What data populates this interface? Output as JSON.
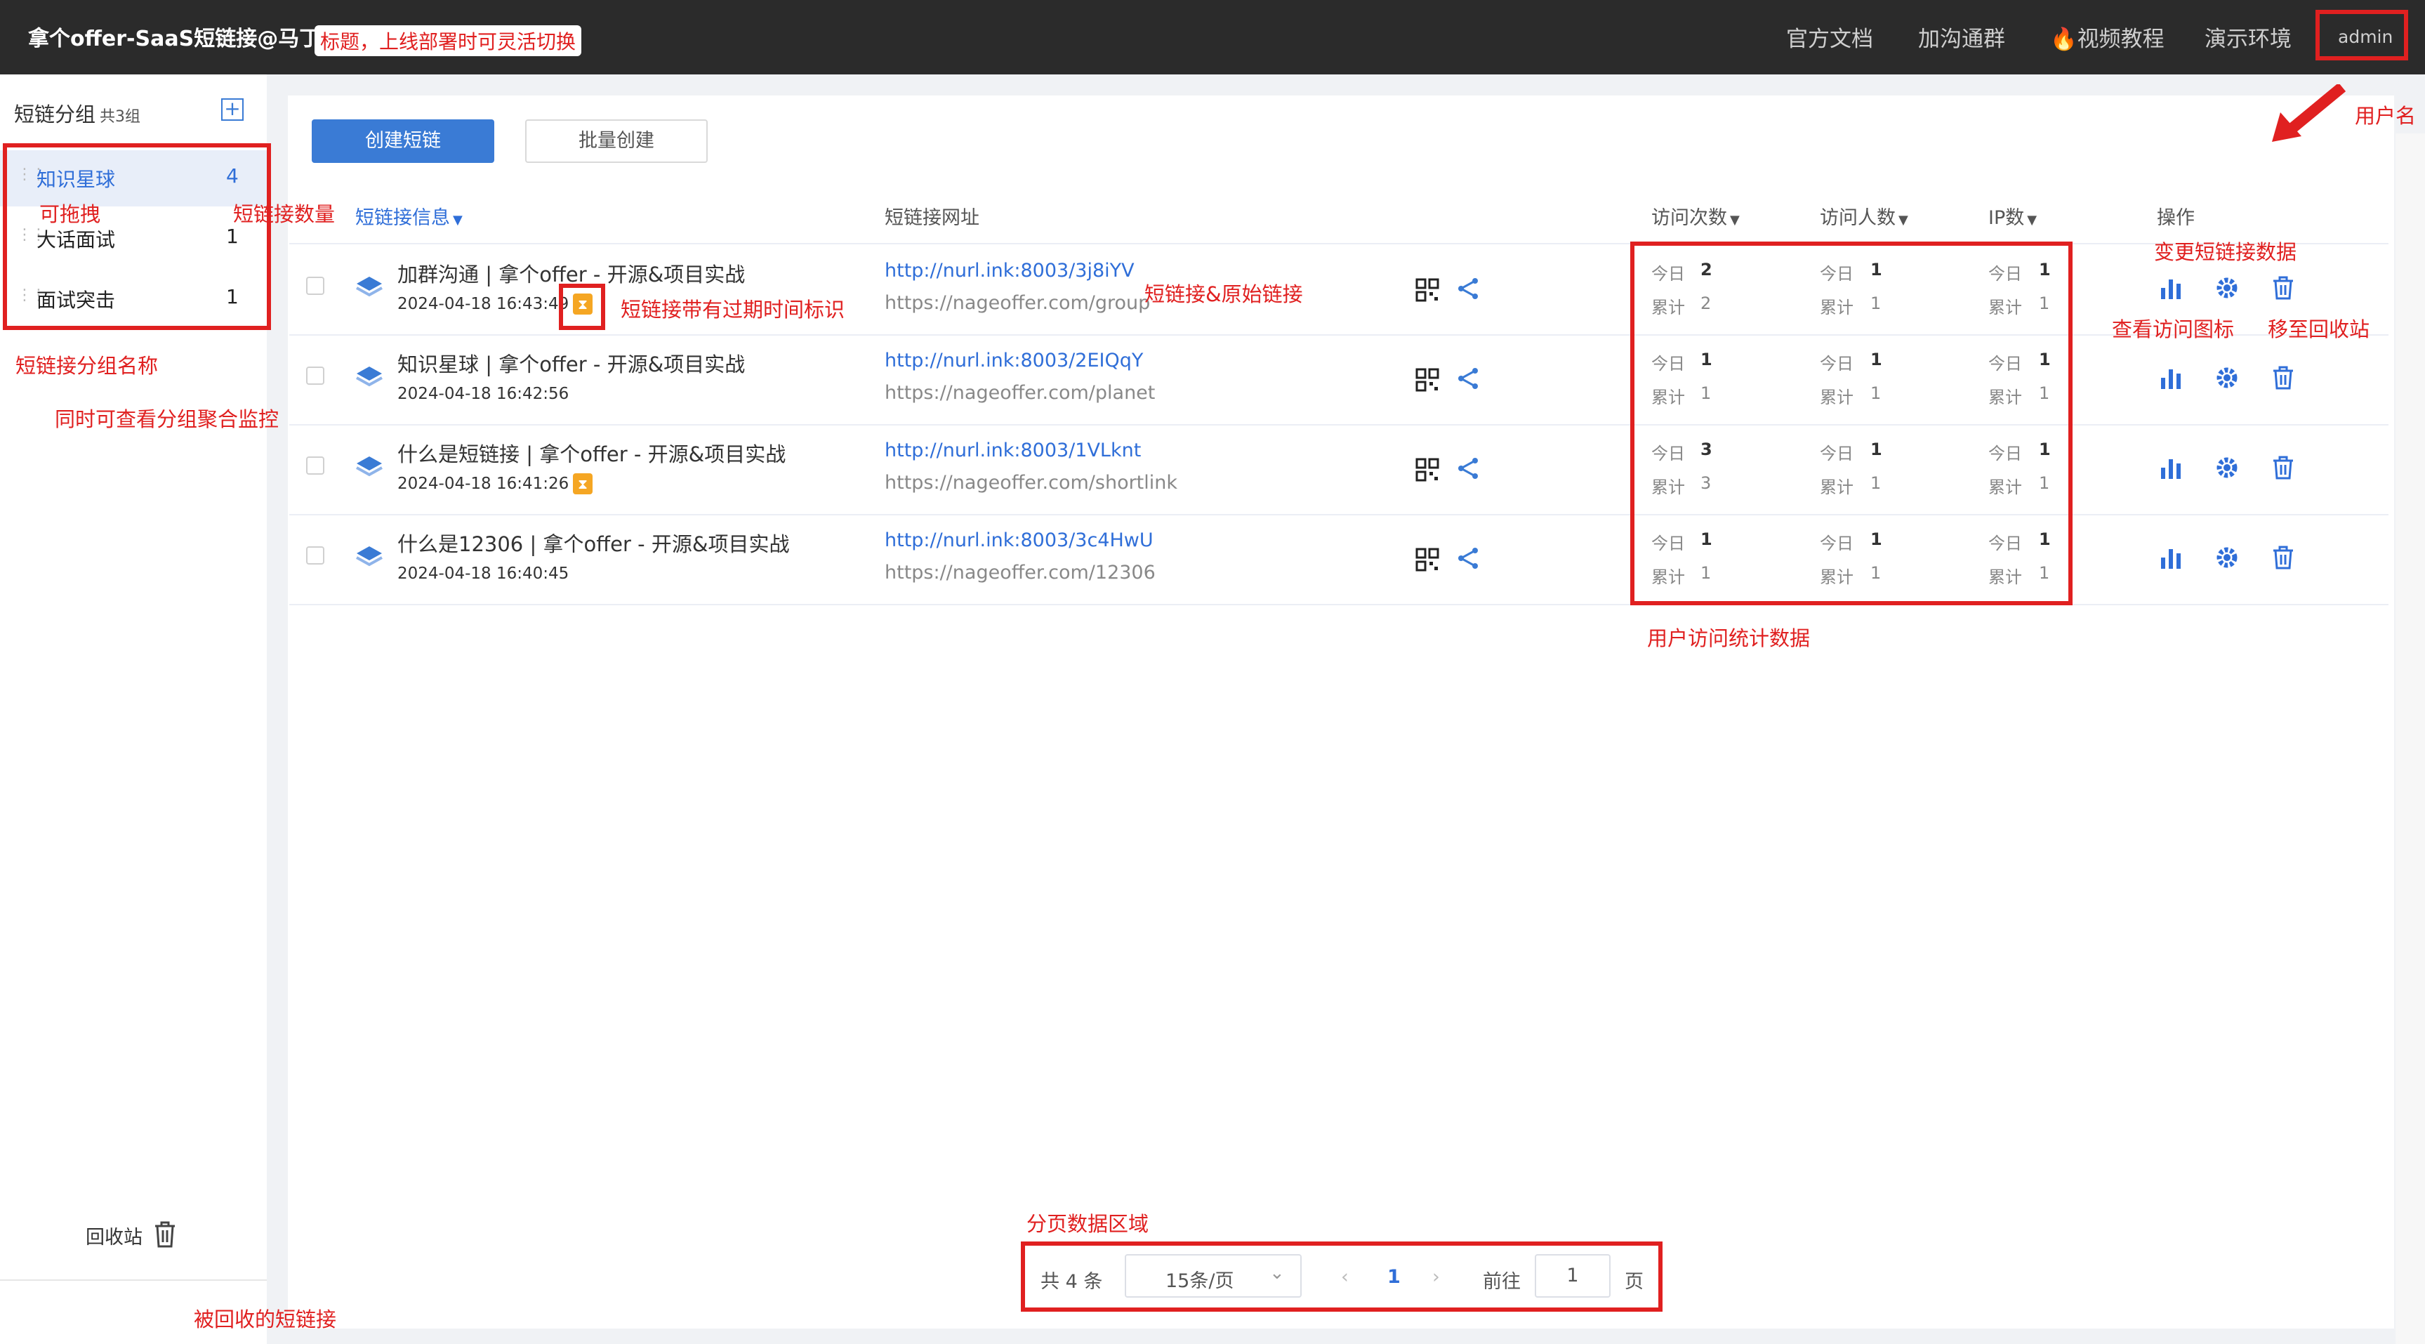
{
  "header": {
    "title": "拿个offer-SaaS短链接@马丁",
    "nav": [
      "官方文档",
      "加沟通群",
      "🔥视频教程",
      "演示环境"
    ],
    "user": "admin"
  },
  "sidebar": {
    "heading": "短链分组",
    "count_label": "共3组",
    "add_icon": "plus-square-icon",
    "groups": [
      {
        "name": "知识星球",
        "count": "4"
      },
      {
        "name": "大话面试",
        "count": "1"
      },
      {
        "name": "面试突击",
        "count": "1"
      }
    ],
    "recycle_label": "回收站"
  },
  "toolbar": {
    "create_label": "创建短链",
    "batch_label": "批量创建"
  },
  "table": {
    "headers": {
      "info": "短链接信息",
      "url": "短链接网址",
      "pv": "访问次数",
      "uv": "访问人数",
      "ip": "IP数",
      "ops": "操作"
    },
    "today_label": "今日",
    "total_label": "累计",
    "rows": [
      {
        "title": "加群沟通 | 拿个offer - 开源&项目实战",
        "date": "2024-04-18 16:43:49",
        "expiry": true,
        "short_url": "http://nurl.ink:8003/3j8iYV",
        "origin_url": "https://nageoffer.com/group",
        "pv_today": "2",
        "pv_total": "2",
        "uv_today": "1",
        "uv_total": "1",
        "ip_today": "1",
        "ip_total": "1"
      },
      {
        "title": "知识星球 | 拿个offer - 开源&项目实战",
        "date": "2024-04-18 16:42:56",
        "expiry": false,
        "short_url": "http://nurl.ink:8003/2EIQqY",
        "origin_url": "https://nageoffer.com/planet",
        "pv_today": "1",
        "pv_total": "1",
        "uv_today": "1",
        "uv_total": "1",
        "ip_today": "1",
        "ip_total": "1"
      },
      {
        "title": "什么是短链接 | 拿个offer - 开源&项目实战",
        "date": "2024-04-18 16:41:26",
        "expiry": true,
        "short_url": "http://nurl.ink:8003/1VLknt",
        "origin_url": "https://nageoffer.com/shortlink",
        "pv_today": "3",
        "pv_total": "3",
        "uv_today": "1",
        "uv_total": "1",
        "ip_today": "1",
        "ip_total": "1"
      },
      {
        "title": "什么是12306 | 拿个offer - 开源&项目实战",
        "date": "2024-04-18 16:40:45",
        "expiry": false,
        "short_url": "http://nurl.ink:8003/3c4HwU",
        "origin_url": "https://nageoffer.com/12306",
        "pv_today": "1",
        "pv_total": "1",
        "uv_today": "1",
        "uv_total": "1",
        "ip_today": "1",
        "ip_total": "1"
      }
    ]
  },
  "pagination": {
    "total": "共 4 条",
    "page_size": "15条/页",
    "current": "1",
    "goto_label": "前往",
    "goto_value": "1",
    "page_suffix": "页"
  },
  "annotations": {
    "title_note": "标题，上线部署时可灵活切换",
    "username": "用户名",
    "draggable": "可拖拽",
    "link_count": "短链接数量",
    "group_name": "短链接分组名称",
    "group_monitor": "同时可查看分组聚合监控",
    "expiry_mark": "短链接带有过期时间标识",
    "short_and_origin": "短链接&原始链接",
    "change_data": "变更短链接数据",
    "view_chart": "查看访问图标",
    "move_recycle": "移至回收站",
    "visit_stats": "用户访问统计数据",
    "pagination_area": "分页数据区域",
    "recycled": "被回收的短链接"
  },
  "colors": {
    "header_bg": "#2b2b2b",
    "accent": "#3a7bd5",
    "annotation": "#e02020",
    "expiry_badge": "#f5a623"
  }
}
